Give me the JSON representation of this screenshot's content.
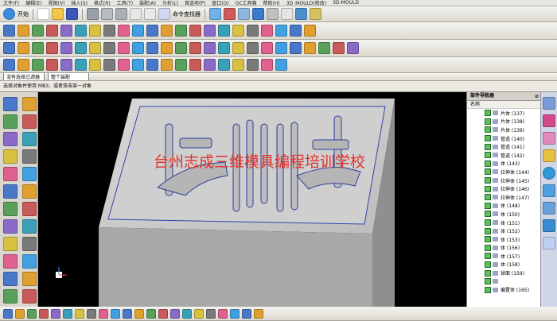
{
  "menubar": {
    "items": [
      "文件(F)",
      "编辑(E)",
      "视图(V)",
      "插入(S)",
      "格式(R)",
      "工具(T)",
      "装配(A)",
      "分析(L)",
      "首选项(P)",
      "窗口(O)",
      "GC工具箱",
      "帮助(H)",
      "3D_MOULD(修改)",
      "3D-MOULD"
    ]
  },
  "toolbar1": {
    "start_label": "开始",
    "cmd_finder_label": "命令查找器"
  },
  "selectionbar": {
    "filter_value": "没有选择过滤器",
    "scope_value": "整个装配"
  },
  "status": {
    "message": "选择对象并使用 MB3，或者双击某一对象"
  },
  "watermark": "台州志成三维模具编程培训学校",
  "navigator": {
    "title": "部件导航器",
    "column_header": "名称",
    "items": [
      "片体 (137)",
      "片体 (138)",
      "片体 (139)",
      "管道 (140)",
      "管道 (141)",
      "管道 (142)",
      "体 (143)",
      "拉伸体 (144)",
      "拉伸体 (145)",
      "拉伸体 (146)",
      "拉伸体 (147)",
      "体 (148)",
      "体 (150)",
      "体 (151)",
      "体 (152)",
      "体 (153)",
      "体 (156)",
      "体 (157)",
      "体 (158)",
      "球面 (159)",
      "",
      "偏置体 (165)"
    ]
  },
  "icons": {
    "toolbar1": [
      "start-icon",
      "new-icon",
      "open-icon",
      "save-icon",
      "cut-icon",
      "copy-icon",
      "paste-icon",
      "undo-icon",
      "redo-icon",
      "cmd-finder-icon",
      "layer-icon",
      "shaded-icon",
      "wireframe-icon",
      "color-icon",
      "arrow-icon",
      "view-icon",
      "view-icon"
    ],
    "toolbar2": [
      "line-icon",
      "arc-icon",
      "circle-icon",
      "spline-icon",
      "point-icon",
      "rect-icon",
      "polygon-icon",
      "ellipse-icon",
      "offset-icon",
      "trim-icon",
      "extend-icon",
      "fillet-icon",
      "chamfer-icon",
      "mirror-icon",
      "pattern-icon",
      "project-icon",
      "intersect-icon",
      "sweep-icon",
      "surface-icon",
      "checker-icon",
      "analysis-icon",
      "bolt-icon"
    ],
    "toolbar3": [
      "extrude-icon",
      "revolve-icon",
      "hole-icon",
      "boss-icon",
      "pocket-icon",
      "pad-icon",
      "slot-icon",
      "groove-icon",
      "blend-icon",
      "chamfer-icon",
      "shell-icon",
      "draft-icon",
      "unite-icon",
      "subtract-icon",
      "intersect-icon",
      "trim-body-icon",
      "split-icon",
      "sew-icon",
      "patch-icon",
      "scale-icon",
      "offset-face-icon",
      "gen-icon",
      "gen-icon",
      "gen-icon",
      "gen-icon"
    ]
  },
  "colors": {
    "accent": "#2b3e9a",
    "watermark": "#e0322c",
    "mold": "#c9c9c9"
  }
}
